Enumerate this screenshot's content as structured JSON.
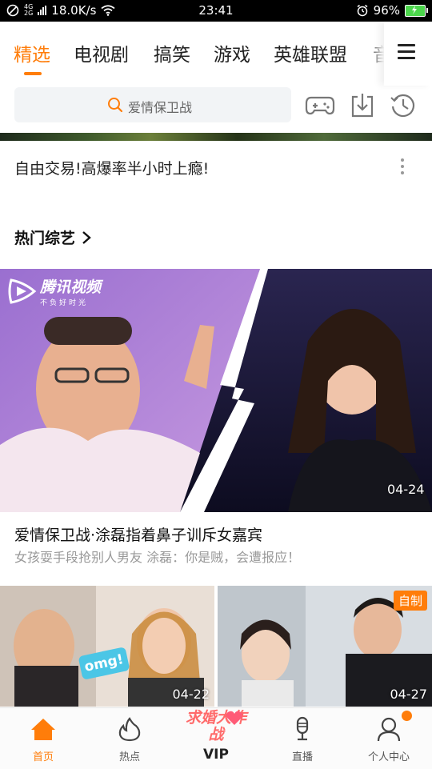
{
  "status_bar": {
    "net_type": "4G",
    "net_type2": "2G",
    "speed": "18.0K/s",
    "time": "23:41",
    "battery": "96%"
  },
  "tabs": [
    {
      "label": "精选",
      "active": true
    },
    {
      "label": "电视剧",
      "active": false
    },
    {
      "label": "搞笑",
      "active": false
    },
    {
      "label": "游戏",
      "active": false
    },
    {
      "label": "英雄联盟",
      "active": false
    },
    {
      "label": "音",
      "active": false
    }
  ],
  "search": {
    "placeholder": "爱情保卫战"
  },
  "toolbar": {
    "icons": [
      "gamepad-icon",
      "download-icon",
      "history-icon"
    ]
  },
  "ad": {
    "title": "自由交易!高爆率半小时上瘾!"
  },
  "section": {
    "title": "热门综艺"
  },
  "hero": {
    "brand": "腾讯视频",
    "brand_slogan": "不负好时光",
    "duration": "04-24",
    "title": "爱情保卫战·涂磊指着鼻子训斥女嘉宾",
    "subtitle": "女孩耍手段抢别人男友 涂磊：你是贼，会遭报应！"
  },
  "thumbs": [
    {
      "duration": "04-22",
      "overlay": "omg!"
    },
    {
      "duration": "04-27",
      "badge": "自制"
    }
  ],
  "bottom_nav": [
    {
      "label": "首页",
      "active": true,
      "icon": "home-icon"
    },
    {
      "label": "热点",
      "active": false,
      "icon": "flame-icon"
    },
    {
      "label": "VIP",
      "active": false,
      "logo": "求婚大作战"
    },
    {
      "label": "直播",
      "active": false,
      "icon": "microphone-icon"
    },
    {
      "label": "个人中心",
      "active": false,
      "icon": "user-icon"
    }
  ],
  "colors": {
    "accent": "#ff7d0a",
    "text": "#222222",
    "subtext": "#999999"
  }
}
